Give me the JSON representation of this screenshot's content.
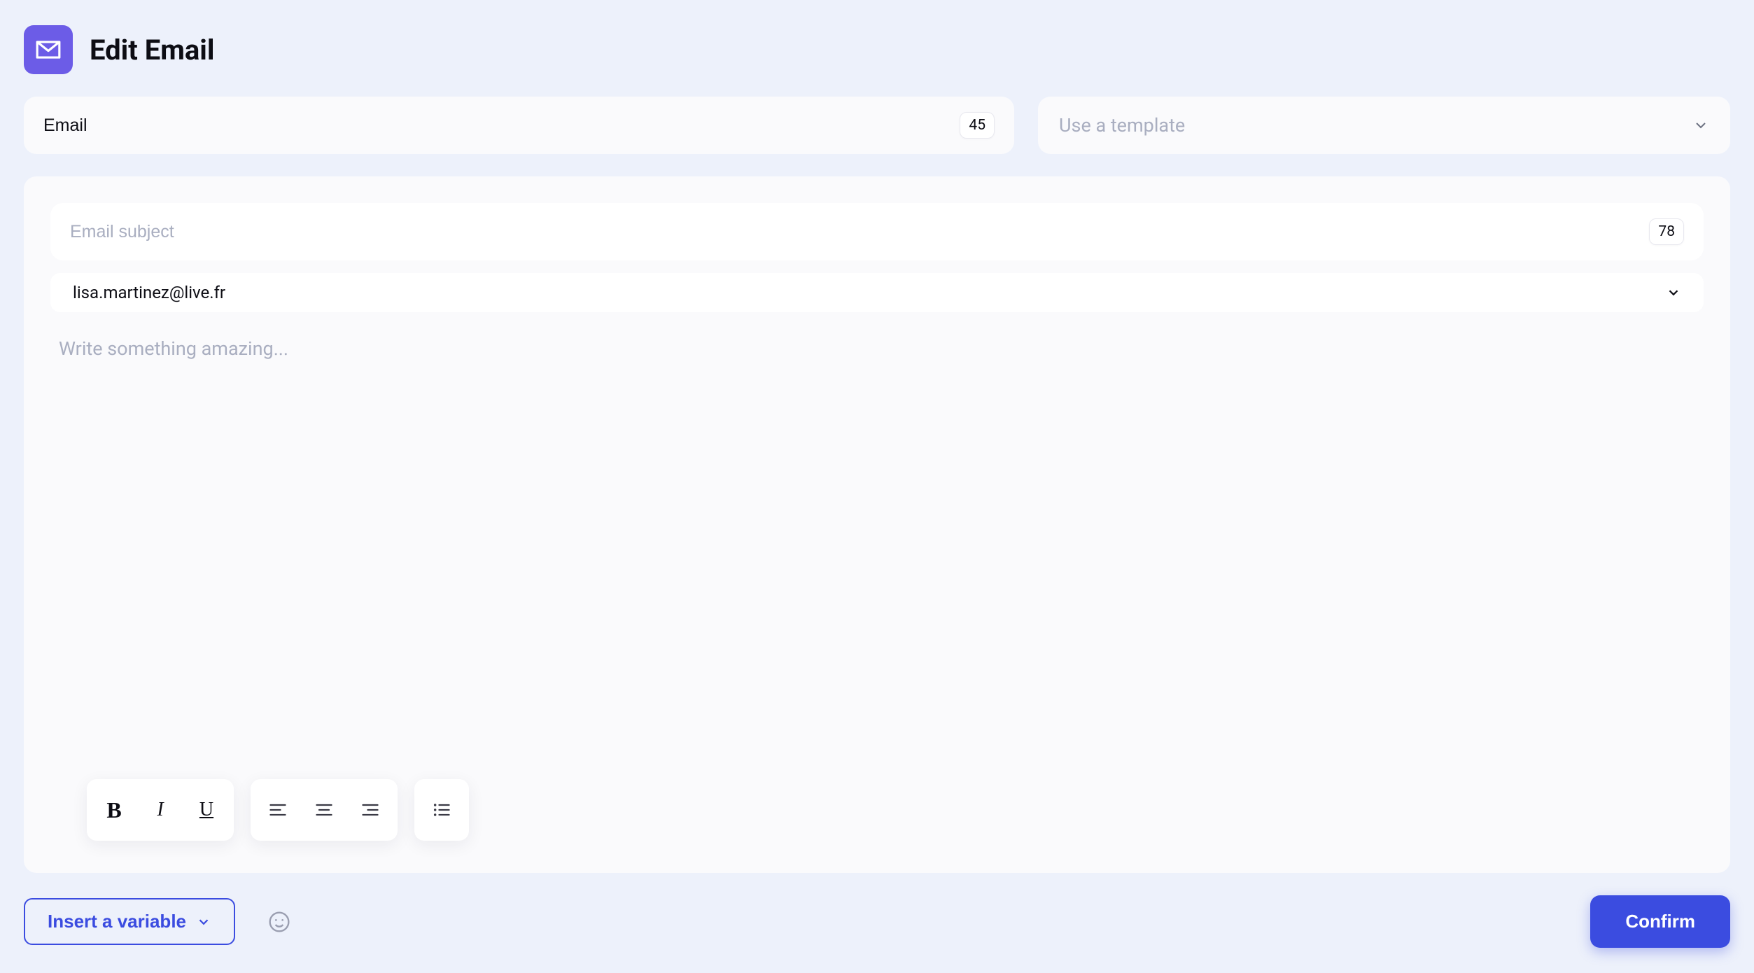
{
  "header": {
    "title": "Edit Email"
  },
  "email_field": {
    "value": "Email",
    "counter": "45"
  },
  "template": {
    "placeholder": "Use a template"
  },
  "subject": {
    "placeholder": "Email subject",
    "value": "",
    "counter": "78"
  },
  "from": {
    "address": "lisa.martinez@live.fr"
  },
  "editor": {
    "placeholder": "Write something amazing...",
    "value": ""
  },
  "footer": {
    "insert_variable_label": "Insert a variable",
    "confirm_label": "Confirm"
  }
}
